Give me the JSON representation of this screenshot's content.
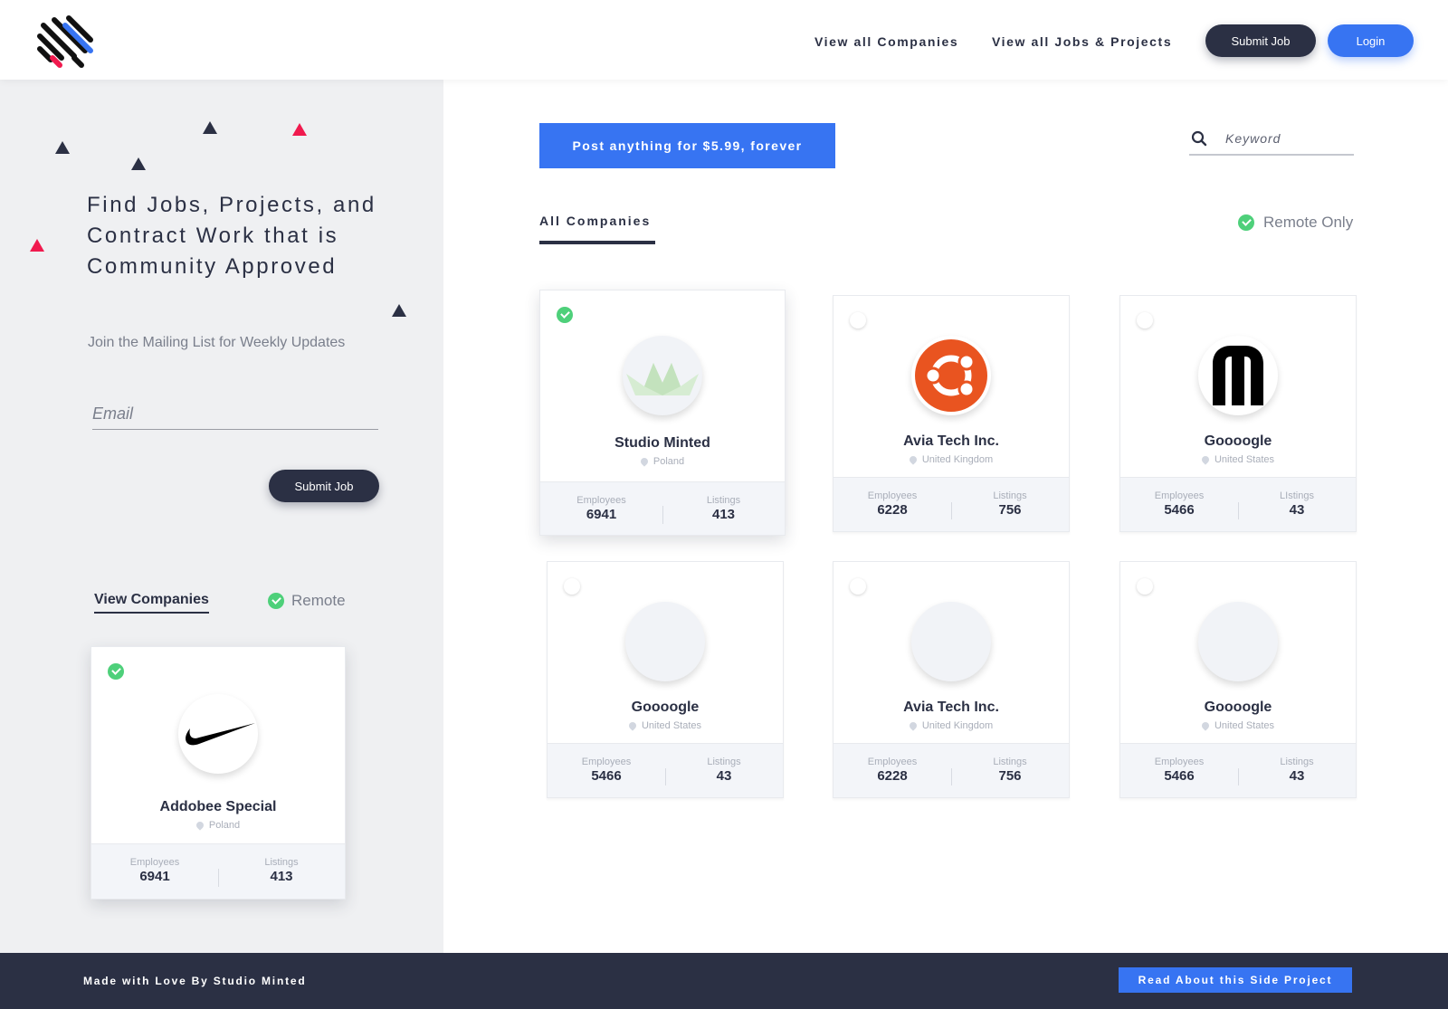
{
  "header": {
    "nav": [
      "View all Companies",
      "View all Jobs & Projects"
    ],
    "submit_label": "Submit Job",
    "login_label": "Login"
  },
  "sidebar": {
    "hero": "Find Jobs, Projects, and Contract Work that is Community Approved",
    "subtitle": "Join the Mailing List for Weekly Updates",
    "email_placeholder": "Email",
    "submit_label": "Submit Job",
    "view_companies_label": "View Companies",
    "remote_label": "Remote",
    "card": {
      "name": "Addobee Special",
      "location": "Poland",
      "employees_label": "Employees",
      "employees": "6941",
      "listings_label": "Listings",
      "listings": "413",
      "selected": true,
      "logo_icon": "nike-swoosh-icon"
    }
  },
  "main": {
    "post_label": "Post anything for $5.99, forever",
    "search_placeholder": "Keyword",
    "tab_label": "All Companies",
    "remote_only_label": "Remote Only",
    "companies": [
      {
        "name": "Studio Minted",
        "location": "Poland",
        "employees_label": "Employees",
        "employees": "6941",
        "listings_label": "Listings",
        "listings": "413",
        "selected": true,
        "logo_icon": "crown-icon"
      },
      {
        "name": "Avia Tech Inc.",
        "location": "United Kingdom",
        "employees_label": "Employees",
        "employees": "6228",
        "listings_label": "Listings",
        "listings": "756",
        "selected": false,
        "logo_icon": "ubuntu-icon"
      },
      {
        "name": "Goooogle",
        "location": "United States",
        "employees_label": "Employees",
        "employees": "5466",
        "listings_label": "LIstings",
        "listings": "43",
        "selected": false,
        "logo_icon": "m-letter-icon"
      },
      {
        "name": "Goooogle",
        "location": "United States",
        "employees_label": "Employees",
        "employees": "5466",
        "listings_label": "Listings",
        "listings": "43",
        "selected": false,
        "logo_icon": ""
      },
      {
        "name": "Avia Tech Inc.",
        "location": "United Kingdom",
        "employees_label": "Employees",
        "employees": "6228",
        "listings_label": "Listings",
        "listings": "756",
        "selected": false,
        "logo_icon": ""
      },
      {
        "name": "Goooogle",
        "location": "United States",
        "employees_label": "Employees",
        "employees": "5466",
        "listings_label": "Listings",
        "listings": "43",
        "selected": false,
        "logo_icon": ""
      }
    ]
  },
  "footer": {
    "credit": "Made with Love By Studio Minted",
    "button_label": "Read About this Side Project"
  },
  "colors": {
    "primary": "#3774f2",
    "dark": "#2b3044",
    "accent_pink": "#f01a4e",
    "check_green": "#4ed07a",
    "sidebar_bg": "#eff0f2"
  }
}
